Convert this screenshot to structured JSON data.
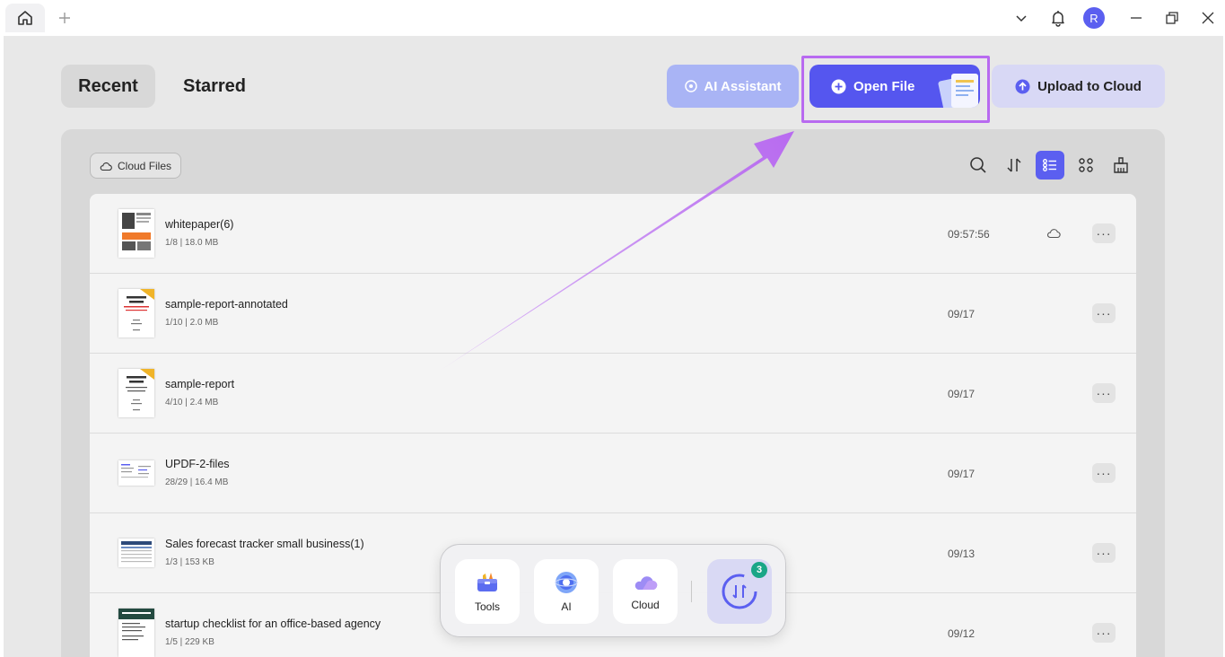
{
  "titlebar": {
    "avatar_letter": "R"
  },
  "tabs": {
    "recent": "Recent",
    "starred": "Starred"
  },
  "actions": {
    "ai_assistant": "AI Assistant",
    "open_file": "Open File",
    "upload_cloud": "Upload to Cloud"
  },
  "panel": {
    "cloud_files": "Cloud Files"
  },
  "icons": {
    "accent": "#5b5ff0",
    "highlight": "#b86af0"
  },
  "files": [
    {
      "name": "whitepaper(6)",
      "meta": "1/8 | 18.0 MB",
      "time": "09:57:56",
      "cloud": true
    },
    {
      "name": "sample-report-annotated",
      "meta": "1/10 | 2.0 MB",
      "time": "09/17",
      "cloud": false
    },
    {
      "name": "sample-report",
      "meta": "4/10 | 2.4 MB",
      "time": "09/17",
      "cloud": false
    },
    {
      "name": "UPDF-2-files",
      "meta": "28/29 | 16.4 MB",
      "time": "09/17",
      "cloud": false
    },
    {
      "name": "Sales forecast tracker small business(1)",
      "meta": "1/3 | 153 KB",
      "time": "09/13",
      "cloud": false
    },
    {
      "name": "startup checklist for an office-based agency",
      "meta": "1/5 | 229 KB",
      "time": "09/12",
      "cloud": false
    }
  ],
  "dock": {
    "tools": "Tools",
    "ai": "AI",
    "cloud": "Cloud",
    "sync_badge": "3"
  }
}
